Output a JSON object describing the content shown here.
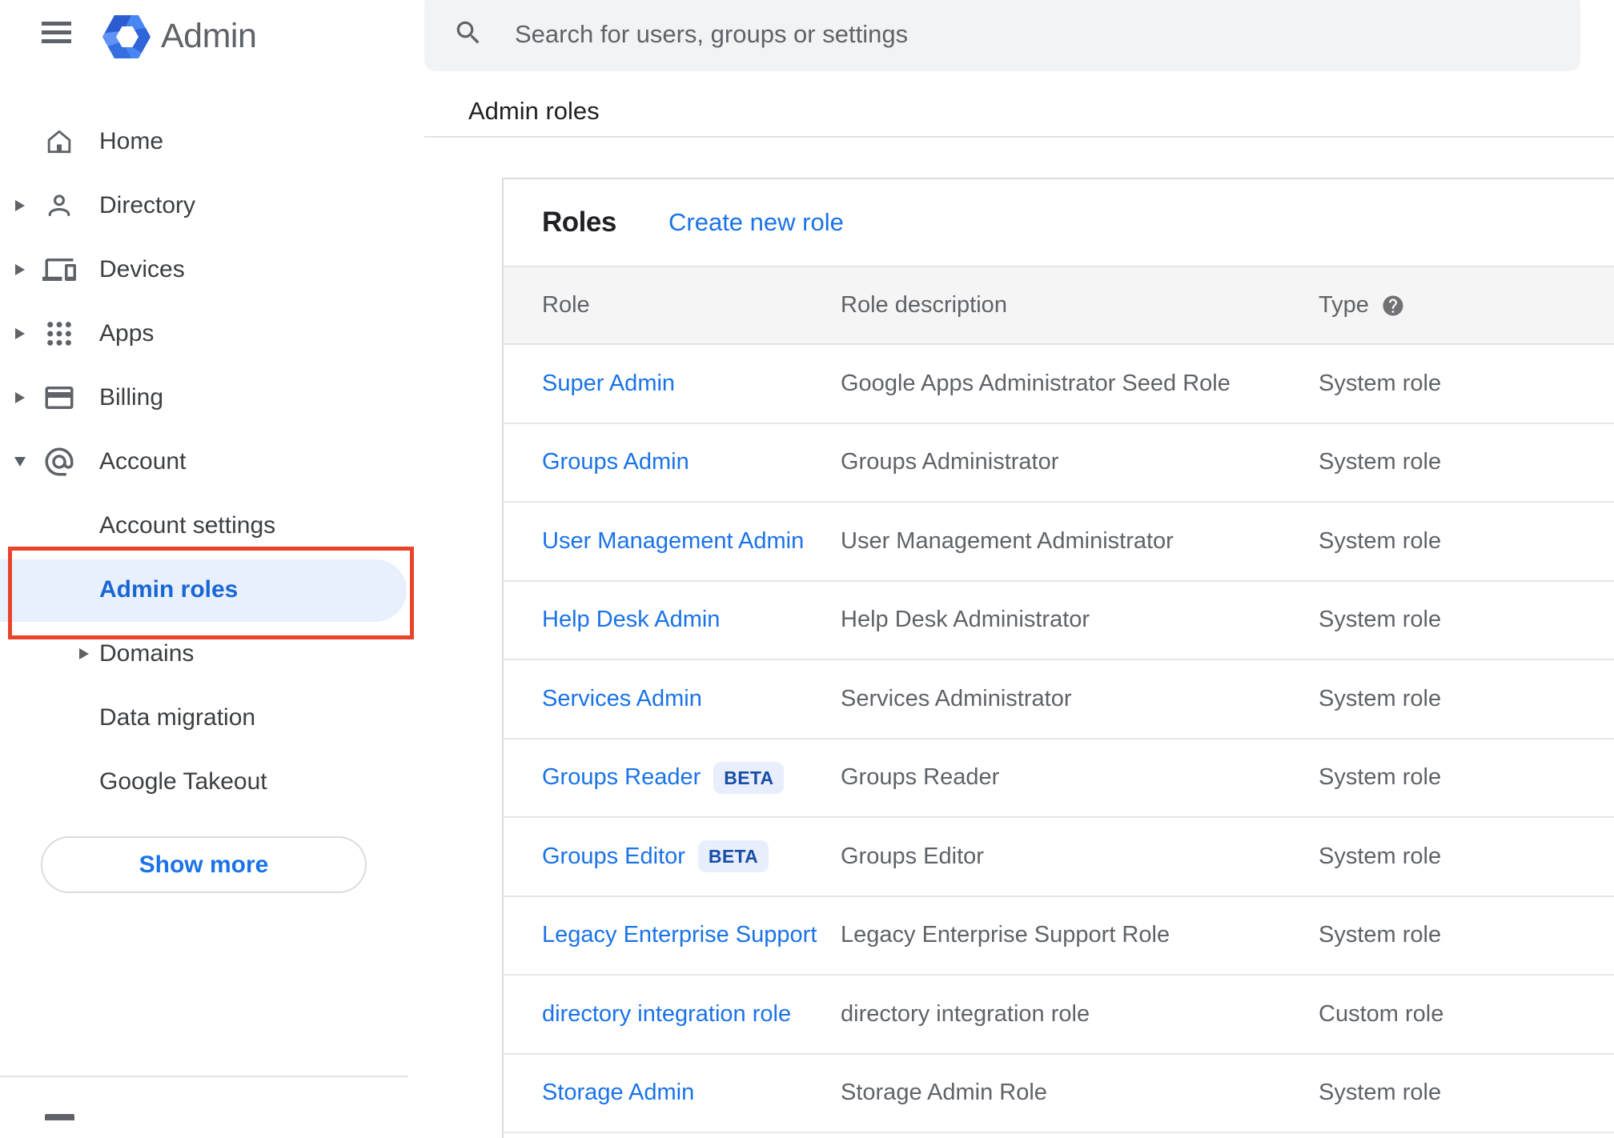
{
  "header": {
    "product_name": "Admin",
    "search_placeholder": "Search for users, groups or settings"
  },
  "breadcrumb": "Admin roles",
  "sidebar": {
    "items": [
      {
        "label": "Home",
        "icon": "home-icon",
        "expandable": false
      },
      {
        "label": "Directory",
        "icon": "person-icon",
        "expandable": true
      },
      {
        "label": "Devices",
        "icon": "devices-icon",
        "expandable": true
      },
      {
        "label": "Apps",
        "icon": "apps-grid-icon",
        "expandable": true
      },
      {
        "label": "Billing",
        "icon": "credit-card-icon",
        "expandable": true
      },
      {
        "label": "Account",
        "icon": "at-sign-icon",
        "expandable": true,
        "expanded": true
      }
    ],
    "sub_items": [
      {
        "label": "Account settings",
        "selected": false,
        "expandable": false
      },
      {
        "label": "Admin roles",
        "selected": true,
        "expandable": false,
        "annotated": true
      },
      {
        "label": "Domains",
        "selected": false,
        "expandable": true
      },
      {
        "label": "Data migration",
        "selected": false,
        "expandable": false
      },
      {
        "label": "Google Takeout",
        "selected": false,
        "expandable": false
      }
    ],
    "show_more_label": "Show more"
  },
  "main": {
    "card_title": "Roles",
    "create_link_label": "Create new role",
    "table": {
      "columns": [
        "Role",
        "Role description",
        "Type"
      ],
      "rows": [
        {
          "role": "Super Admin",
          "beta": false,
          "description": "Google Apps Administrator Seed Role",
          "type": "System role"
        },
        {
          "role": "Groups Admin",
          "beta": false,
          "description": "Groups Administrator",
          "type": "System role"
        },
        {
          "role": "User Management Admin",
          "beta": false,
          "description": "User Management Administrator",
          "type": "System role"
        },
        {
          "role": "Help Desk Admin",
          "beta": false,
          "description": "Help Desk Administrator",
          "type": "System role"
        },
        {
          "role": "Services Admin",
          "beta": false,
          "description": "Services Administrator",
          "type": "System role"
        },
        {
          "role": "Groups Reader",
          "beta": true,
          "beta_label": "BETA",
          "description": "Groups Reader",
          "type": "System role"
        },
        {
          "role": "Groups Editor",
          "beta": true,
          "beta_label": "BETA",
          "description": "Groups Editor",
          "type": "System role"
        },
        {
          "role": "Legacy Enterprise Support",
          "beta": false,
          "description": "Legacy Enterprise Support Role",
          "type": "System role"
        },
        {
          "role": "directory integration role",
          "beta": false,
          "description": "directory integration role",
          "type": "Custom role"
        },
        {
          "role": "Storage Admin",
          "beta": false,
          "description": "Storage Admin Role",
          "type": "System role"
        }
      ]
    }
  },
  "colors": {
    "link_blue": "#1a73e8",
    "selected_blue": "#1967d2",
    "selected_pill_bg": "#e8f0fe",
    "annotation_red": "#e8442a",
    "icon_gray": "#5f6368",
    "text_dark": "#202124",
    "search_bg": "#f1f3f4",
    "table_header_bg": "#f5f5f5",
    "divider": "#e1e3e6",
    "beta_bg": "#e8eefc",
    "beta_text": "#174ea6"
  }
}
